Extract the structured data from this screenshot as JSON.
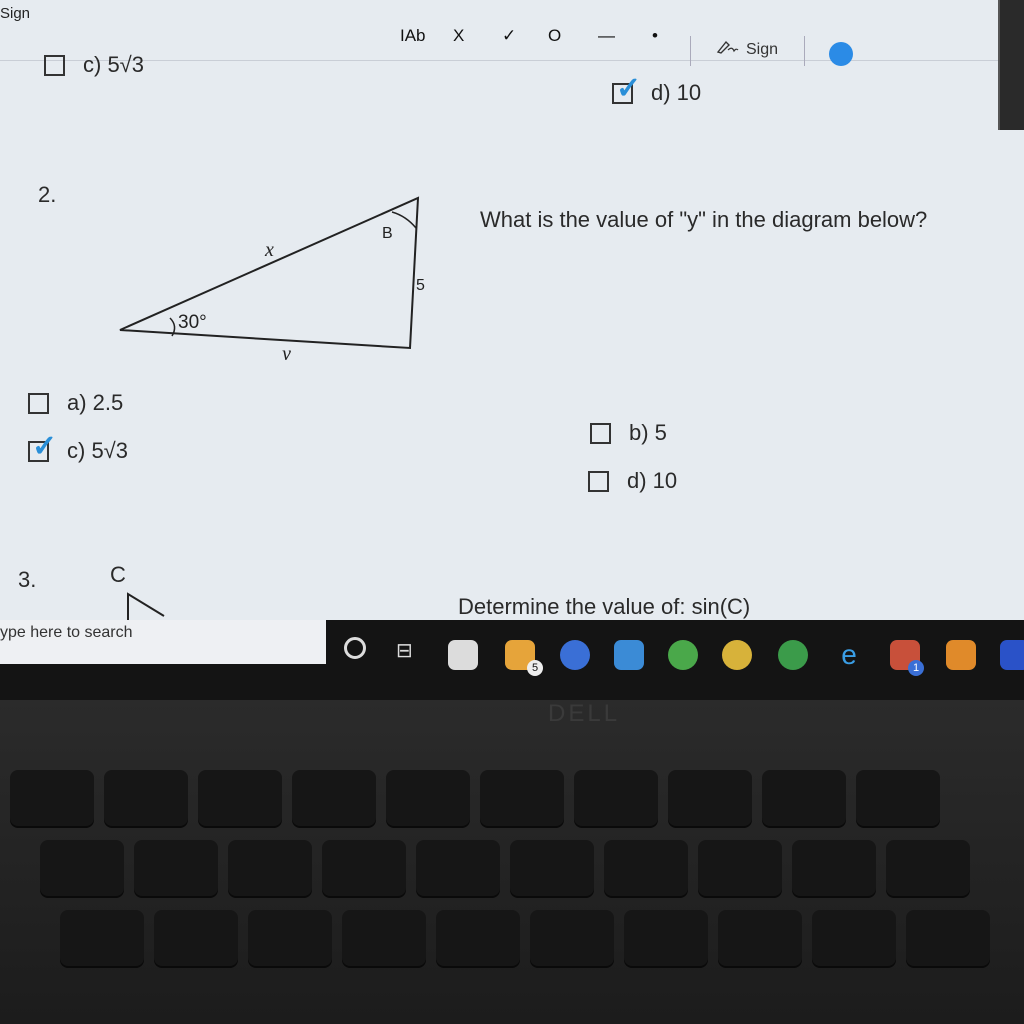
{
  "toolbar": {
    "partial_title": "Sign",
    "text_tool": "IAb",
    "cross_tool": "X",
    "check_tool": "✓",
    "circle_tool": "O",
    "line_tool": "—",
    "dot_tool": "•",
    "sign_label": "Sign",
    "color": "#2b8be6"
  },
  "prev_question": {
    "option_c": "c) 5√3",
    "option_d": "d) 10",
    "option_d_checked": true
  },
  "question2": {
    "number": "2.",
    "text": "What is the value of \"y\" in the diagram below?",
    "diagram": {
      "angle_label": "30°",
      "vertex_label": "B",
      "side_x": "x",
      "side_y": "y",
      "side_5": "5"
    },
    "options": [
      {
        "label": "a) 2.5",
        "checked": false
      },
      {
        "label": "b) 5",
        "checked": false
      },
      {
        "label": "c) 5√3",
        "checked": true
      },
      {
        "label": "d) 10",
        "checked": false
      }
    ]
  },
  "question3": {
    "number": "3.",
    "vertex_label": "C",
    "text": "Determine the value of: sin(C)"
  },
  "taskbar": {
    "search_placeholder": "ype here to search",
    "mail_badge": "5",
    "teams_badge": "1"
  },
  "laptop": {
    "brand": "DELL"
  }
}
